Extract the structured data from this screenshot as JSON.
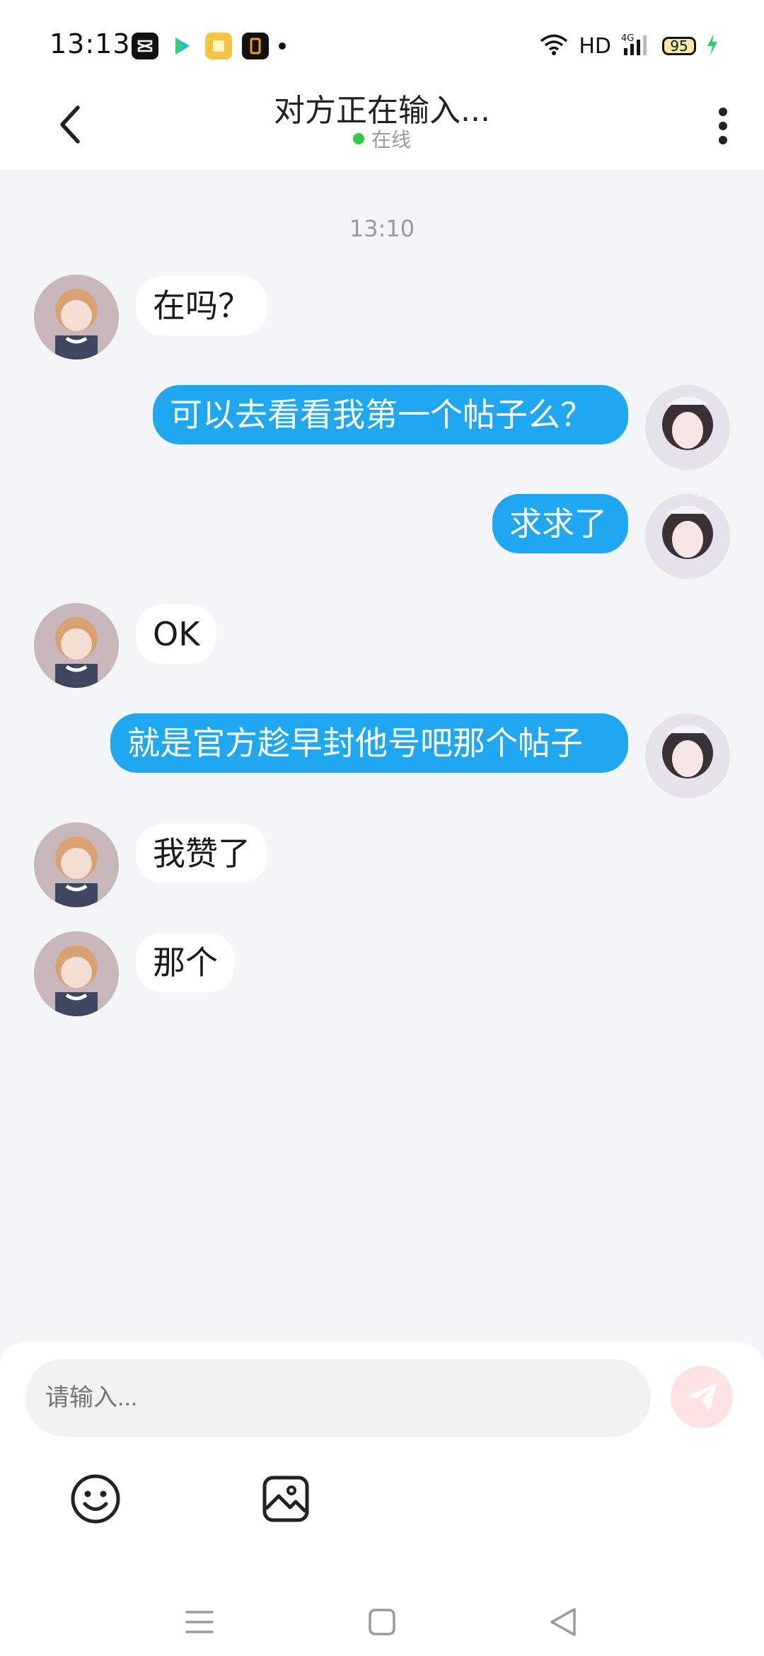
{
  "status_bar": {
    "time": "13:13",
    "hd_label": "HD",
    "network_label": "4G",
    "battery_level": "95",
    "icons": [
      "capcut-icon",
      "play-icon",
      "yellow-app-icon",
      "orange-app-icon",
      "wifi-icon",
      "signal-icon",
      "battery-icon",
      "charging-icon"
    ]
  },
  "header": {
    "title": "对方正在输入...",
    "presence": "在线",
    "presence_color": "#2ecc40"
  },
  "chat": {
    "timestamp": "13:10",
    "messages": [
      {
        "side": "in",
        "text": "在吗？"
      },
      {
        "side": "out",
        "text": "可以去看看我第一个帖子么？"
      },
      {
        "side": "out",
        "text": "求求了"
      },
      {
        "side": "in",
        "text": "OK"
      },
      {
        "side": "out",
        "text": "就是官方趁早封他号吧那个帖子"
      },
      {
        "side": "in",
        "text": "我赞了"
      },
      {
        "side": "in",
        "text": "那个"
      }
    ],
    "outgoing_color": "#1fa7f2",
    "incoming_color": "#ffffff"
  },
  "composer": {
    "placeholder": "请输入...",
    "tools": [
      "emoji-icon",
      "image-icon"
    ],
    "send_icon": "send-icon"
  },
  "nav_bar": {
    "buttons": [
      "menu-icon",
      "home-icon",
      "back-triangle-icon"
    ]
  }
}
